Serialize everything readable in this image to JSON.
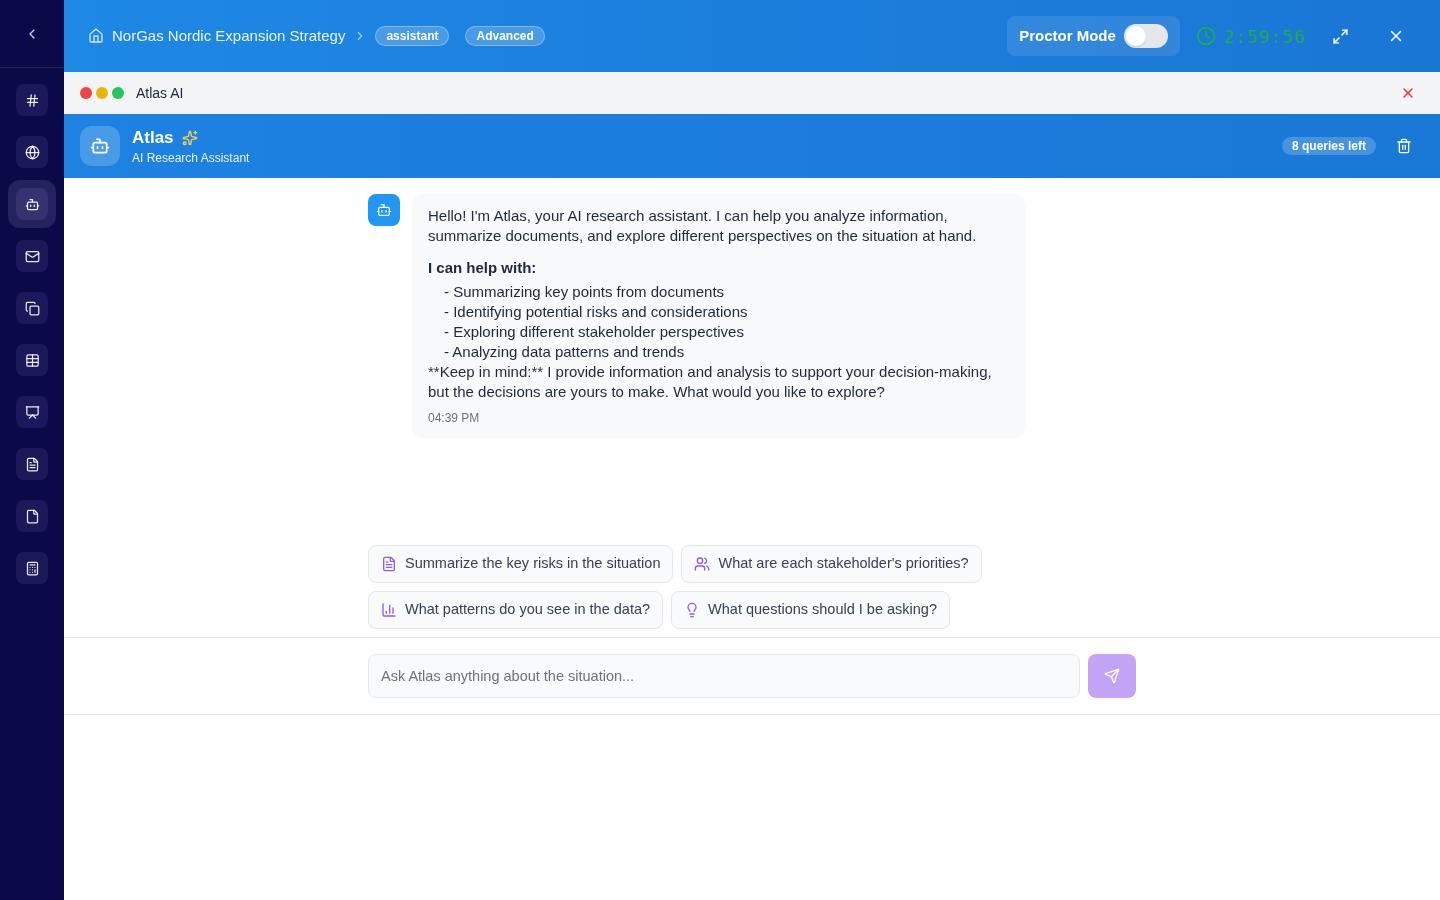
{
  "sidebar": {
    "items": [
      {
        "kind": "hash",
        "selected": false
      },
      {
        "kind": "globe",
        "selected": false
      },
      {
        "kind": "bot",
        "selected": true
      },
      {
        "kind": "mail",
        "selected": false
      },
      {
        "kind": "copy",
        "selected": false
      },
      {
        "kind": "table",
        "selected": false
      },
      {
        "kind": "presentation",
        "selected": false
      },
      {
        "kind": "document",
        "selected": false
      },
      {
        "kind": "file",
        "selected": false
      },
      {
        "kind": "calculator",
        "selected": false
      }
    ]
  },
  "header": {
    "breadcrumb": "NorGas Nordic Expansion Strategy",
    "badges": [
      "assistant",
      "Advanced"
    ],
    "proctor_mode": {
      "label": "Proctor Mode",
      "on": false
    },
    "timer": "2:59:56"
  },
  "window": {
    "title": "Atlas AI"
  },
  "assistant": {
    "name": "Atlas",
    "subtitle": "AI Research Assistant",
    "queries_left": "8 queries left"
  },
  "messages": [
    {
      "intro": "Hello! I'm Atlas, your AI research assistant. I can help you analyze information, summarize documents, and explore different perspectives on the situation at hand.",
      "heading": "I can help with:",
      "bullets": [
        "- Summarizing key points from documents",
        "- Identifying potential risks and considerations",
        "- Exploring different stakeholder perspectives",
        "- Analyzing data patterns and trends"
      ],
      "closing": "**Keep in mind:** I provide information and analysis to support your decision-making, but the decisions are yours to make. What would you like to explore?",
      "time": "04:39 PM"
    }
  ],
  "suggestions": [
    {
      "kind": "document",
      "text": "Summarize the key risks in the situation"
    },
    {
      "kind": "users",
      "text": "What are each stakeholder's priorities?"
    },
    {
      "kind": "chart",
      "text": "What patterns do you see in the data?"
    },
    {
      "kind": "idea",
      "text": "What questions should I be asking?"
    }
  ],
  "composer": {
    "placeholder": "Ask Atlas anything about the situation...",
    "send_disabled": true
  }
}
